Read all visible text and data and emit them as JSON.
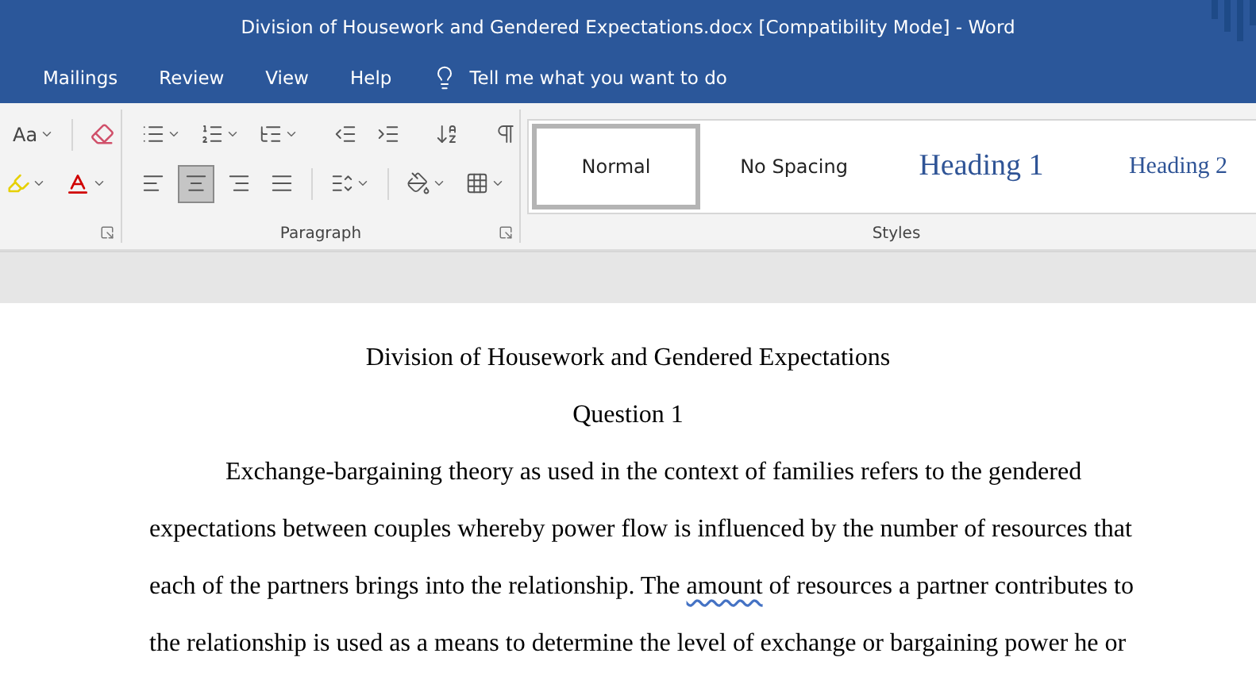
{
  "window": {
    "title": "Division of Housework and Gendered Expectations.docx [Compatibility Mode]  -  Word"
  },
  "menu": [
    {
      "label": "Mailings"
    },
    {
      "label": "Review"
    },
    {
      "label": "View"
    },
    {
      "label": "Help"
    }
  ],
  "tell_me": {
    "placeholder": "Tell me what you want to do"
  },
  "font_group": {
    "case_label": "Aa"
  },
  "paragraph_group": {
    "label": "Paragraph",
    "row_1": [
      {
        "kind": "bullets"
      },
      {
        "kind": "numbering"
      },
      {
        "kind": "multilevel"
      },
      {
        "kind": "outdent"
      },
      {
        "kind": "indent"
      },
      {
        "kind": "sort"
      },
      {
        "kind": "pilcrow"
      }
    ],
    "row_2": [
      {
        "kind": "align-left",
        "selected": false
      },
      {
        "kind": "align-center",
        "selected": true
      },
      {
        "kind": "align-right",
        "selected": false
      },
      {
        "kind": "justify",
        "selected": false
      },
      {
        "kind": "line-spacing",
        "selected": false
      },
      {
        "kind": "shading",
        "selected": false
      },
      {
        "kind": "borders",
        "selected": false
      }
    ]
  },
  "styles_group": {
    "label": "Styles",
    "items": [
      {
        "label": "Normal",
        "kind": "normal",
        "selected": true
      },
      {
        "label": "No Spacing",
        "kind": "normal",
        "selected": false
      },
      {
        "label": "Heading 1",
        "kind": "heading1",
        "selected": false
      },
      {
        "label": "Heading 2",
        "kind": "heading2",
        "selected": false
      }
    ]
  },
  "document": {
    "title": "Division of Housework and Gendered Expectations",
    "subtitle": "Question 1",
    "lines": [
      {
        "indent": true,
        "segments": [
          {
            "text": "Exchange-bargaining theory as used in the context of families refers to the gendered",
            "flagged": false
          }
        ]
      },
      {
        "indent": false,
        "segments": [
          {
            "text": "expectations between couples whereby power flow is influenced by the number of resources that",
            "flagged": false
          }
        ]
      },
      {
        "indent": false,
        "segments": [
          {
            "text": "each of the partners brings into the relationship. The ",
            "flagged": false
          },
          {
            "text": "amount",
            "flagged": true
          },
          {
            "text": " of resources a partner contributes to",
            "flagged": false
          }
        ]
      },
      {
        "indent": false,
        "segments": [
          {
            "text": "the relationship is used as a means to determine the level of exchange or bargaining power he or",
            "flagged": false
          }
        ]
      }
    ]
  }
}
